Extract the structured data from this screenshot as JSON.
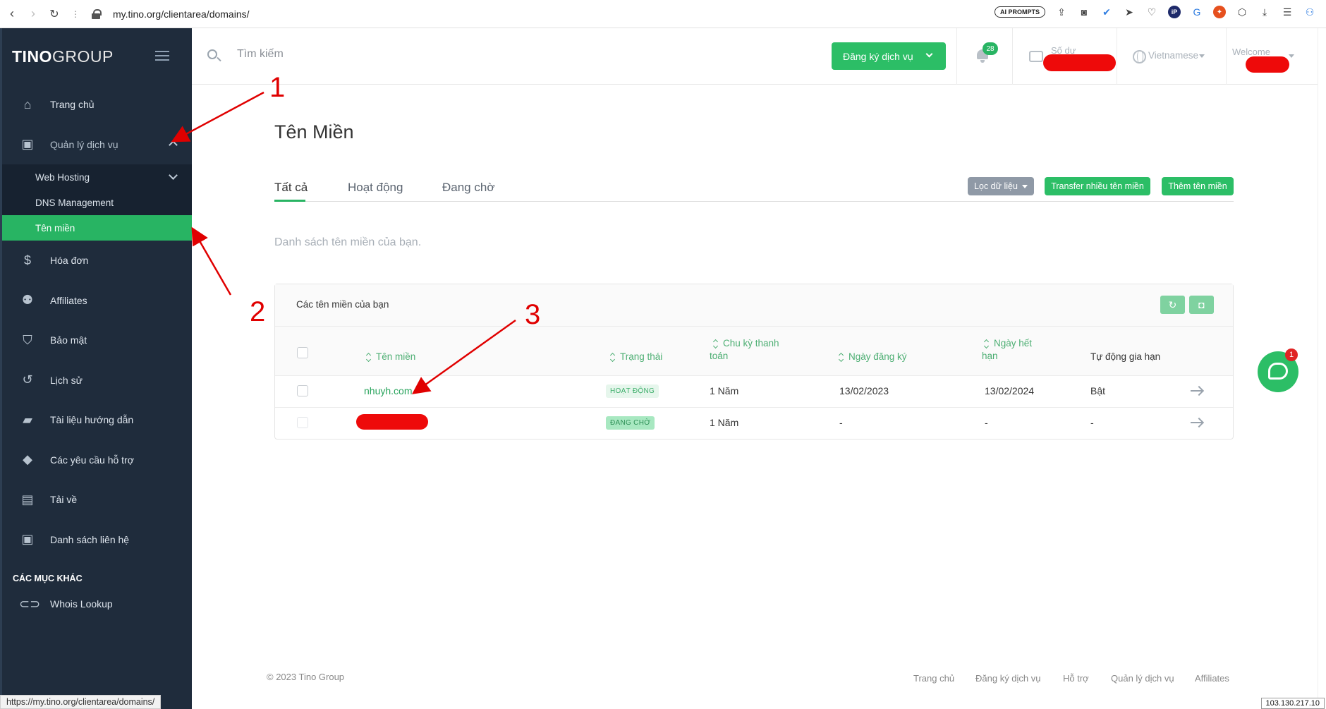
{
  "browser": {
    "url": "my.tino.org/clientarea/domains/",
    "ai_prompts_label": "AI PROMPTS",
    "status_url": "https://my.tino.org/clientarea/domains/",
    "ip": "103.130.217.10"
  },
  "sidebar": {
    "logo_bold": "TINO",
    "logo_thin": "GROUP",
    "items": [
      {
        "label": "Trang chủ",
        "icon": "home-icon"
      },
      {
        "label": "Quản lý dịch vụ",
        "icon": "account-box-icon"
      },
      {
        "label": "Hóa đơn",
        "icon": "dollar-icon"
      },
      {
        "label": "Affiliates",
        "icon": "users-add-icon"
      },
      {
        "label": "Bảo mật",
        "icon": "shield-icon"
      },
      {
        "label": "Lịch sử",
        "icon": "history-icon"
      },
      {
        "label": "Tài liệu hướng dẫn",
        "icon": "document-icon"
      },
      {
        "label": "Các yêu cầu hỗ trợ",
        "icon": "ticket-icon"
      },
      {
        "label": "Tải về",
        "icon": "save-icon"
      },
      {
        "label": "Danh sách liên hệ",
        "icon": "contact-icon"
      }
    ],
    "sub_items": [
      {
        "label": "Web Hosting"
      },
      {
        "label": "DNS Management"
      },
      {
        "label": "Tên miền"
      }
    ],
    "section_label": "CÁC MỤC KHÁC",
    "extra_items": [
      {
        "label": "Whois Lookup",
        "icon": "link-icon"
      }
    ]
  },
  "topbar": {
    "search_placeholder": "Tìm kiếm",
    "register_button": "Đăng ký dịch vụ",
    "notification_count": "28",
    "balance_label": "Số dư",
    "language": "Vietnamese",
    "welcome": "Welcome"
  },
  "page": {
    "title": "Tên Miền",
    "tabs": [
      {
        "label": "Tất cả",
        "active": true
      },
      {
        "label": "Hoạt động",
        "active": false
      },
      {
        "label": "Đang chờ",
        "active": false
      }
    ],
    "filter_button": "Lọc dữ liệu",
    "transfer_button": "Transfer nhiều tên miền",
    "add_button": "Thêm tên miền",
    "lead_text": "Danh sách tên miền của bạn."
  },
  "table": {
    "card_title": "Các tên miền của bạn",
    "columns": {
      "domain": "Tên miền",
      "status": "Trạng thái",
      "cycle_line1": "Chu kỳ thanh",
      "cycle_line2": "toán",
      "reg_date": "Ngày đăng ký",
      "exp_line1": "Ngày hết",
      "exp_line2": "hạn",
      "auto_renew": "Tự động gia hạn"
    },
    "rows": [
      {
        "domain": "nhuyh.com",
        "status": "HOẠT ĐỘNG",
        "cycle": "1 Năm",
        "reg_date": "13/02/2023",
        "exp_date": "13/02/2024",
        "auto_renew": "Bật"
      },
      {
        "domain": "",
        "status": "ĐANG CHỜ",
        "cycle": "1 Năm",
        "reg_date": "-",
        "exp_date": "-",
        "auto_renew": "-"
      }
    ]
  },
  "chat": {
    "badge": "1"
  },
  "footer": {
    "copyright": "© 2023 Tino Group",
    "links": [
      "Trang chủ",
      "Đăng ký dịch vụ",
      "Hỗ trợ",
      "Quản lý dịch vụ",
      "Affiliates"
    ]
  },
  "annotations": [
    "1",
    "2",
    "3"
  ],
  "colors": {
    "brand_green": "#2cbe66",
    "sidebar_bg": "#1f2c3c",
    "annotation_red": "#e00000"
  }
}
